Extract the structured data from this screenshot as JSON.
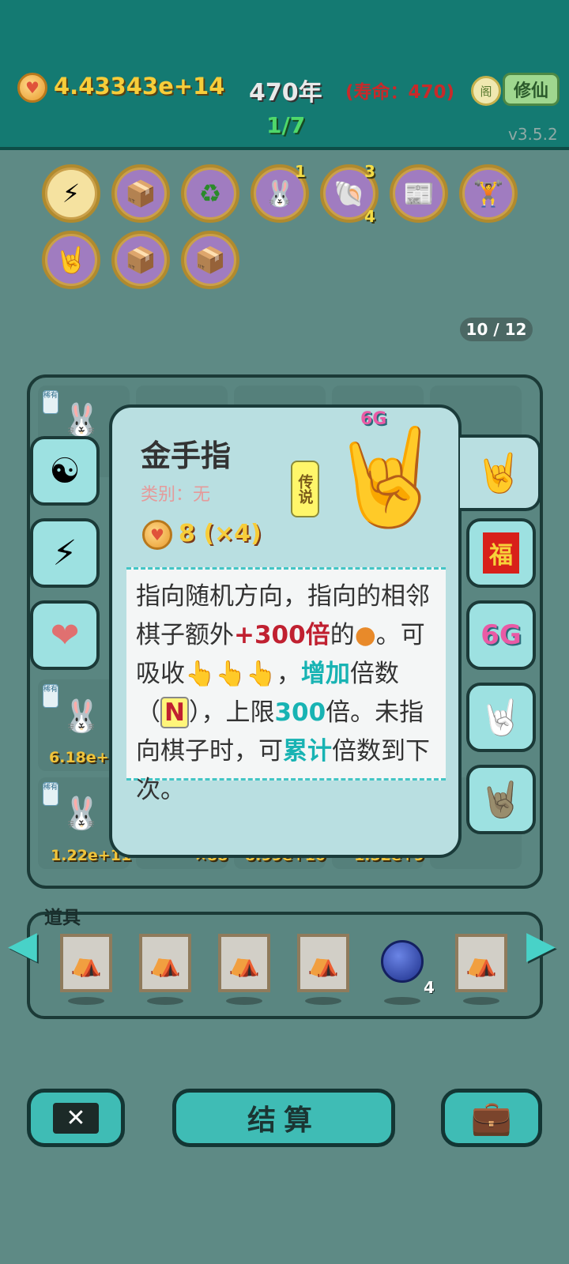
{
  "header": {
    "money": "4.43343e+14",
    "year": "470年",
    "lifespan": "(寿命：470)",
    "pavilion_icon": "阁",
    "cultivate_label": "修仙",
    "round": "1/7",
    "version": "v3.5.2"
  },
  "relics": [
    {
      "icon": "lightning-icon",
      "glyph": "⚡",
      "count": ""
    },
    {
      "icon": "tissue-box-icon",
      "glyph": "📦",
      "count": ""
    },
    {
      "icon": "recycle-icon",
      "glyph": "♻",
      "count": ""
    },
    {
      "icon": "bunny-icon",
      "glyph": "🐰",
      "count": "1"
    },
    {
      "icon": "shell-icon",
      "glyph": "🐚",
      "count": "3",
      "count2": "4"
    },
    {
      "icon": "time-magazine-icon",
      "glyph": "📰",
      "count": ""
    },
    {
      "icon": "dumbbell-icon",
      "glyph": "🏋",
      "count": ""
    },
    {
      "icon": "rock-hand-icon",
      "glyph": "🤘",
      "count": ""
    },
    {
      "icon": "tissue-box-icon",
      "glyph": "📦",
      "count": ""
    },
    {
      "icon": "tissue-box-icon",
      "glyph": "📦",
      "count": ""
    }
  ],
  "pager": "10 / 12",
  "board": {
    "tag_text": "稀有",
    "visible_values": [
      "6.18e+",
      "1.22e+11",
      "×88",
      "8.99e+10",
      "1.52e+9"
    ]
  },
  "popup": {
    "title": "金手指",
    "category": "类别：无",
    "cost": "8 (×4)",
    "rarity": "传说",
    "badge": "6G",
    "desc_parts": {
      "p1": "指向随机方向，指向的相邻棋子额外",
      "bonus": "+300倍",
      "p2": "的",
      "p3": "。可吸收",
      "p4": "，",
      "increase": "增加",
      "p5": "倍数（",
      "n": "N",
      "p6": "），上限",
      "limit": "300",
      "p7": "倍。未指向棋子时，可",
      "accumulate": "累计",
      "p8": "倍数到下次。"
    }
  },
  "side_left": [
    {
      "icon": "yin-yang-icon",
      "glyph": "☯"
    },
    {
      "icon": "lightning-icon",
      "glyph": "⚡"
    },
    {
      "icon": "liver-icon",
      "glyph": "🫁"
    }
  ],
  "side_right": [
    {
      "icon": "fu-icon",
      "glyph": "福"
    },
    {
      "icon": "6g-icon",
      "glyph": "6G"
    },
    {
      "icon": "white-rock-hand-icon",
      "glyph": "🤘"
    },
    {
      "icon": "brown-rock-hand-icon",
      "glyph": "🤘"
    }
  ],
  "items": {
    "label": "道具",
    "slots": [
      {
        "icon": "tent-card-icon",
        "count": ""
      },
      {
        "icon": "tent-card-icon",
        "count": ""
      },
      {
        "icon": "tent-card-icon",
        "count": ""
      },
      {
        "icon": "tent-card-icon",
        "count": ""
      },
      {
        "icon": "blueberry-icon",
        "count": "4"
      },
      {
        "icon": "tent-card-icon",
        "count": ""
      }
    ]
  },
  "bottom": {
    "settle_label": "结算"
  },
  "colors": {
    "topbar": "#147a72",
    "background": "#5e8a85",
    "accent": "#3fbcb5",
    "gold": "#f7cd3a"
  }
}
